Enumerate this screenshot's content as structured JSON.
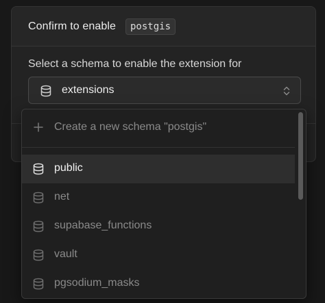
{
  "modal": {
    "title": "Confirm to enable",
    "extension_name": "postgis",
    "label": "Select a schema to enable the extension for",
    "selected_schema": "extensions"
  },
  "dropdown": {
    "create_label": "Create a new schema \"postgis\"",
    "options": [
      {
        "label": "public",
        "selected": true
      },
      {
        "label": "net",
        "selected": false
      },
      {
        "label": "supabase_functions",
        "selected": false
      },
      {
        "label": "vault",
        "selected": false
      },
      {
        "label": "pgsodium_masks",
        "selected": false
      }
    ]
  },
  "icons": {
    "schema": "database-icon",
    "create": "plus-icon",
    "select": "chevrons-up-down-icon"
  },
  "colors": {
    "background": "#181818",
    "surface": "#232323",
    "text_primary": "#ededed",
    "text_muted": "#8a8a8a"
  }
}
